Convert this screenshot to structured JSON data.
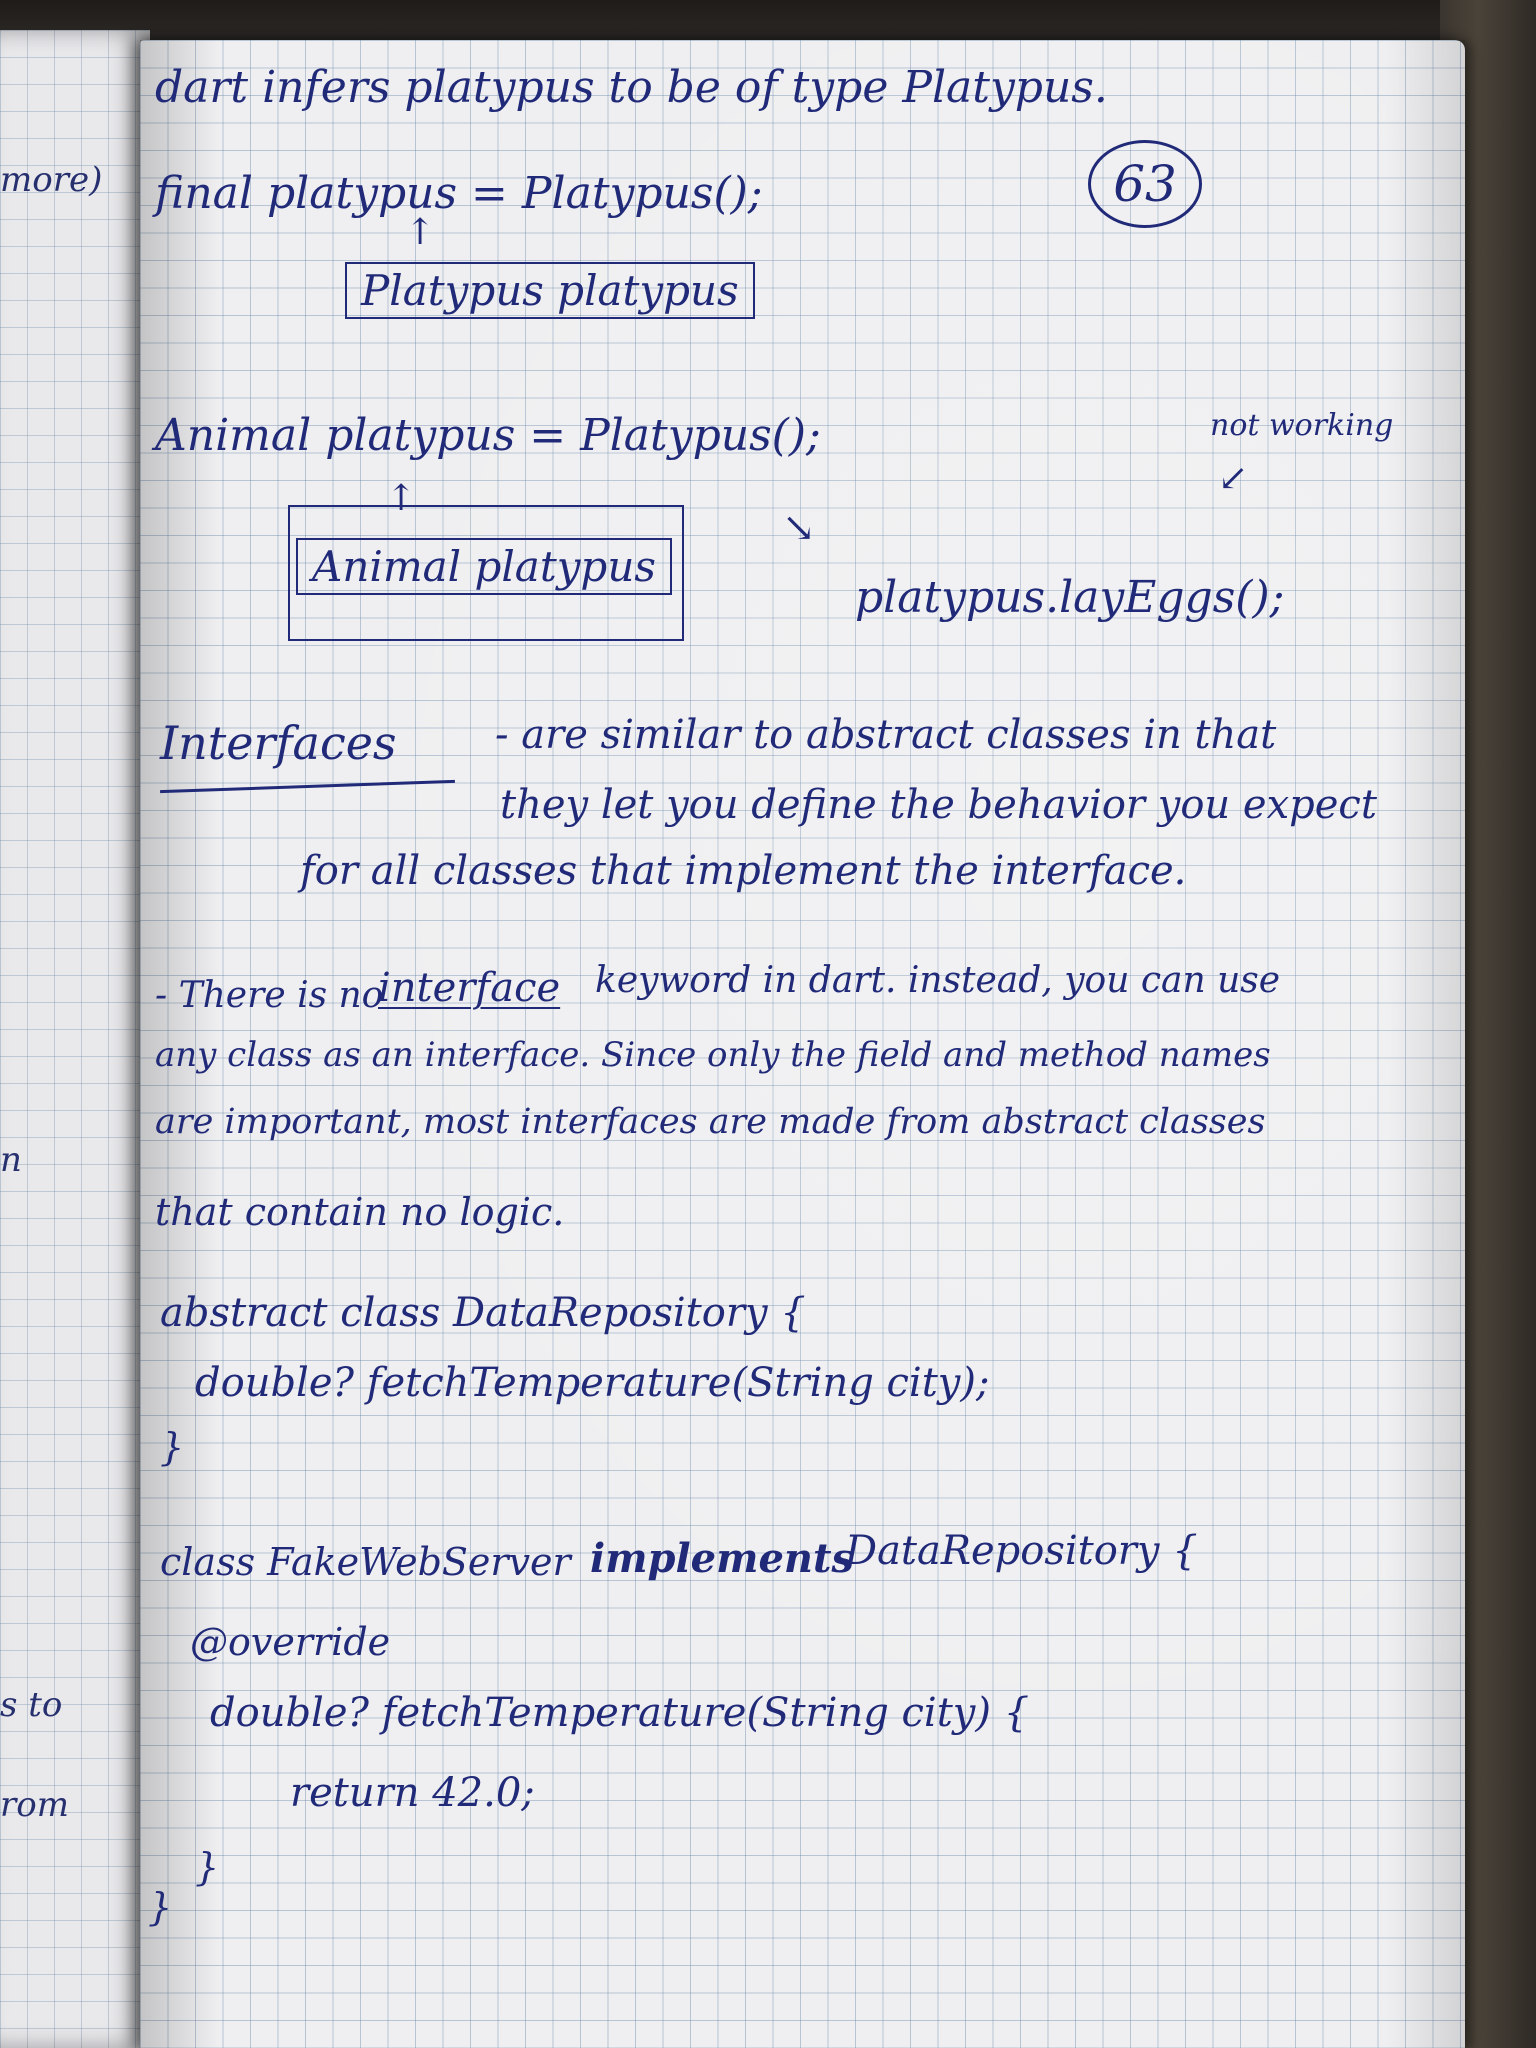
{
  "left_page": {
    "snippets": [
      "more)",
      "n",
      "s to",
      "rom"
    ]
  },
  "page": {
    "page_number": "63",
    "lines": {
      "l1": "dart infers platypus to be of type Platypus.",
      "l2": "final platypus = Platypus();",
      "l3": "Platypus platypus",
      "l4": "Animal platypus = Platypus();",
      "l5": "not working",
      "l6": "Animal platypus",
      "l7": "platypus.layEggs();",
      "heading": "Interfaces",
      "l8": "- are similar to abstract classes in that",
      "l9": "they let you define the behavior you expect",
      "l10": "for all classes that implement the interface.",
      "l11a": "- There is no",
      "l11b": "interface",
      "l11c": "keyword in dart. instead, you can use",
      "l12": "any class as an interface. Since only the field and method names",
      "l13": "are important, most interfaces are made from abstract classes",
      "l14": "that contain no logic.",
      "code1": "abstract class DataRepository {",
      "code2": "double? fetchTemperature(String city);",
      "code3": "}",
      "code4a": "class FakeWebServer",
      "code4b": "implements",
      "code4c": "DataRepository {",
      "code5": "@override",
      "code6": "double? fetchTemperature(String city) {",
      "code7": "return 42.0;",
      "code8": "}",
      "code9": "}"
    }
  },
  "colors": {
    "ink": "#202a78",
    "paper": "#efeff1",
    "grid": "#6987aa"
  }
}
